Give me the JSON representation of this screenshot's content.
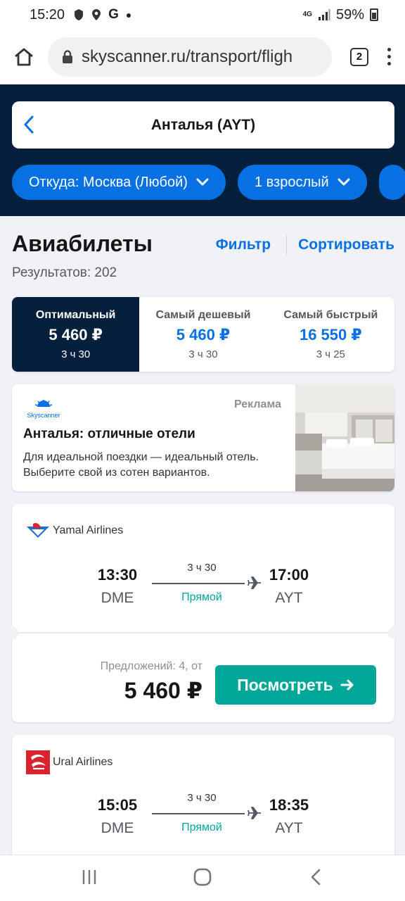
{
  "status_bar": {
    "time": "15:20",
    "network": "4G",
    "battery": "59%",
    "notification_icons": [
      "security-icon",
      "location-icon",
      "google-icon",
      "dot-icon"
    ]
  },
  "browser": {
    "url": "skyscanner.ru/transport/fligh",
    "tab_count": "2"
  },
  "header": {
    "search_title": "Анталья (AYT)",
    "chips": [
      "Откуда: Москва (Любой)",
      "1 взрослый"
    ]
  },
  "results": {
    "title": "Авиабилеты",
    "filter_label": "Фильтр",
    "sort_label": "Сортировать",
    "count": "Результатов: 202"
  },
  "sort_tabs": [
    {
      "label": "Оптимальный",
      "price": "5 460 ₽",
      "duration": "3 ч 30",
      "active": true
    },
    {
      "label": "Самый дешевый",
      "price": "5 460 ₽",
      "duration": "3 ч 30",
      "active": false
    },
    {
      "label": "Самый быстрый",
      "price": "16 550 ₽",
      "duration": "3 ч 25",
      "active": false
    }
  ],
  "ad": {
    "brand": "Skyscanner",
    "label": "Реклама",
    "title": "Анталья: отличные отели",
    "text": "Для идеальной поездки — идеальный отель. Выберите свой из сотен вариантов."
  },
  "flights": [
    {
      "airline": "Yamal Airlines",
      "dep_time": "13:30",
      "dep_code": "DME",
      "duration": "3 ч 30",
      "stops": "Прямой",
      "arr_time": "17:00",
      "arr_code": "AYT",
      "offers": "Предложений: 4, от",
      "price": "5 460 ₽",
      "button": "Посмотреть"
    },
    {
      "airline": "Ural Airlines",
      "dep_time": "15:05",
      "dep_code": "DME",
      "duration": "3 ч 30",
      "stops": "Прямой",
      "arr_time": "18:35",
      "arr_code": "AYT"
    }
  ],
  "colors": {
    "brand_dark": "#05203c",
    "brand_blue": "#0770e3",
    "accent_green": "#00a698"
  }
}
